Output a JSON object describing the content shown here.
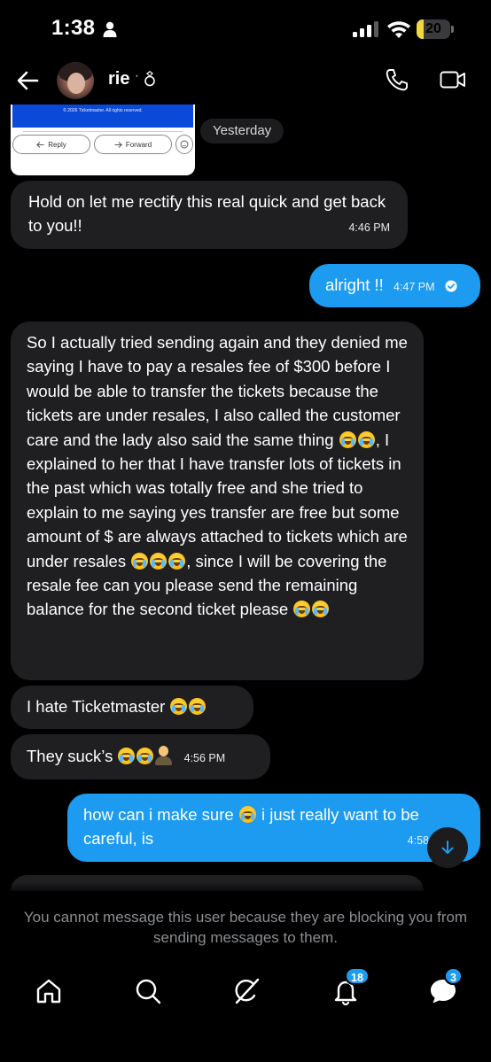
{
  "status_bar": {
    "time": "1:38",
    "battery_level": "20",
    "battery_fraction": 0.2
  },
  "header": {
    "contact_name": "rie ̖ ̖💍",
    "contact_name_text": "rie",
    "contact_name_suffix": "ʾ💍"
  },
  "email_preview": {
    "footer_text": "© 2026 Ticketmaster. All rights reserved.",
    "reply_label": "Reply",
    "forward_label": "Forward"
  },
  "day_separator": "Yesterday",
  "messages": [
    {
      "direction": "in",
      "text": "Hold on let me rectify this real quick and get back to you!!",
      "time": "4:46 PM"
    },
    {
      "direction": "out",
      "text": "alright !!",
      "time": "4:47 PM",
      "status": "read"
    },
    {
      "direction": "in",
      "text_parts": [
        "So I actually tried sending again and they denied me saying I have to pay a resales fee of $300 before I would be able to transfer the tickets because the tickets are under resales, I also called the customer care and the lady also said the same thing",
        ", I explained to her that I have transfer lots of tickets in the past which was totally free and she tried to explain to me saying yes transfer are free but some amount of $ are always attached to tickets which are under resales",
        ", since I will be covering the resale fee can you please send the remaining balance for the second ticket please"
      ]
    },
    {
      "direction": "in",
      "text": "I hate Ticketmaster"
    },
    {
      "direction": "in",
      "text": "They suck’s",
      "time": "4:56 PM"
    },
    {
      "direction": "out",
      "text_before_emoji": "how can i make sure",
      "text_after_emoji": "i just really want to be careful, is",
      "time": "4:58"
    }
  ],
  "blocked_notice": "You cannot message this user because they are blocking you from sending messages to them.",
  "bottom_nav": {
    "notifications_badge": "18",
    "messages_badge": "3"
  },
  "icons": {
    "status": [
      "person-icon",
      "signal-icon",
      "wifi-icon",
      "battery-icon"
    ],
    "header": [
      "back-arrow-icon",
      "phone-icon",
      "video-icon"
    ],
    "nav": [
      "home-icon",
      "search-icon",
      "grok-icon",
      "bell-icon",
      "messages-icon"
    ]
  },
  "colors": {
    "background": "#000000",
    "incoming_bubble": "#1f1f21",
    "outgoing_bubble": "#1d9bf0",
    "muted_text": "#8a8d91",
    "battery": "#f3d83b"
  }
}
